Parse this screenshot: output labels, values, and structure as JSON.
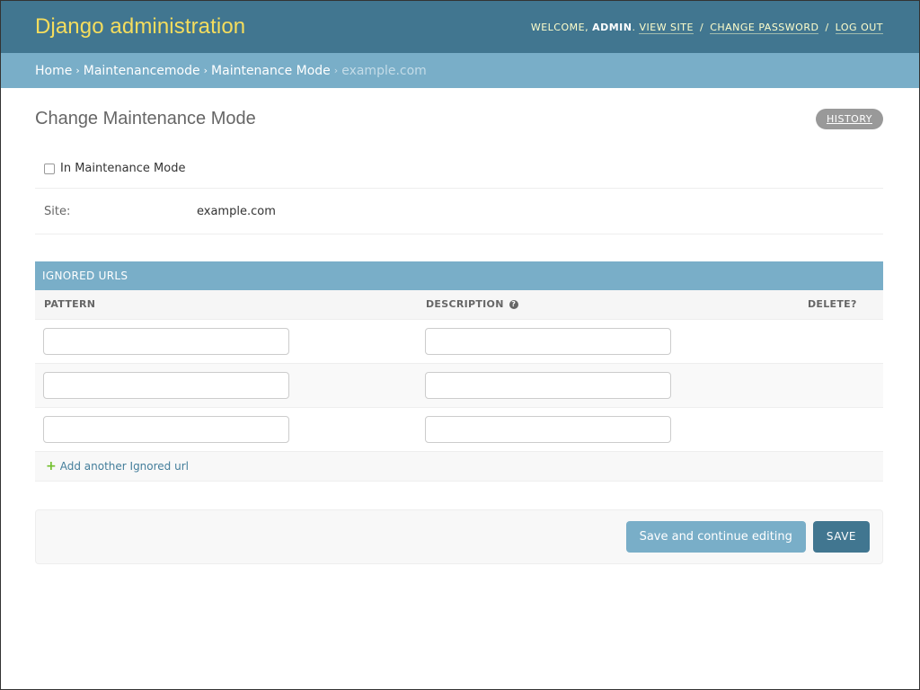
{
  "header": {
    "site_name": "Django administration",
    "welcome": "Welcome,",
    "username": "admin",
    "view_site": "View site",
    "change_password": "Change password",
    "log_out": "Log out"
  },
  "breadcrumbs": {
    "home": "Home",
    "app": "Maintenancemode",
    "model": "Maintenance Mode",
    "current": "example.com"
  },
  "page": {
    "title": "Change Maintenance Mode",
    "history_label": "History"
  },
  "form": {
    "maintenance_label": "In Maintenance Mode",
    "maintenance_checked": false,
    "site_label": "Site:",
    "site_value": "example.com"
  },
  "inline": {
    "title": "Ignored urls",
    "col_pattern": "Pattern",
    "col_description": "Description",
    "col_delete": "Delete?",
    "rows": [
      {
        "pattern": "",
        "description": ""
      },
      {
        "pattern": "",
        "description": ""
      },
      {
        "pattern": "",
        "description": ""
      }
    ],
    "add_label": "Add another Ignored url"
  },
  "submit": {
    "continue_label": "Save and continue editing",
    "save_label": "Save"
  }
}
